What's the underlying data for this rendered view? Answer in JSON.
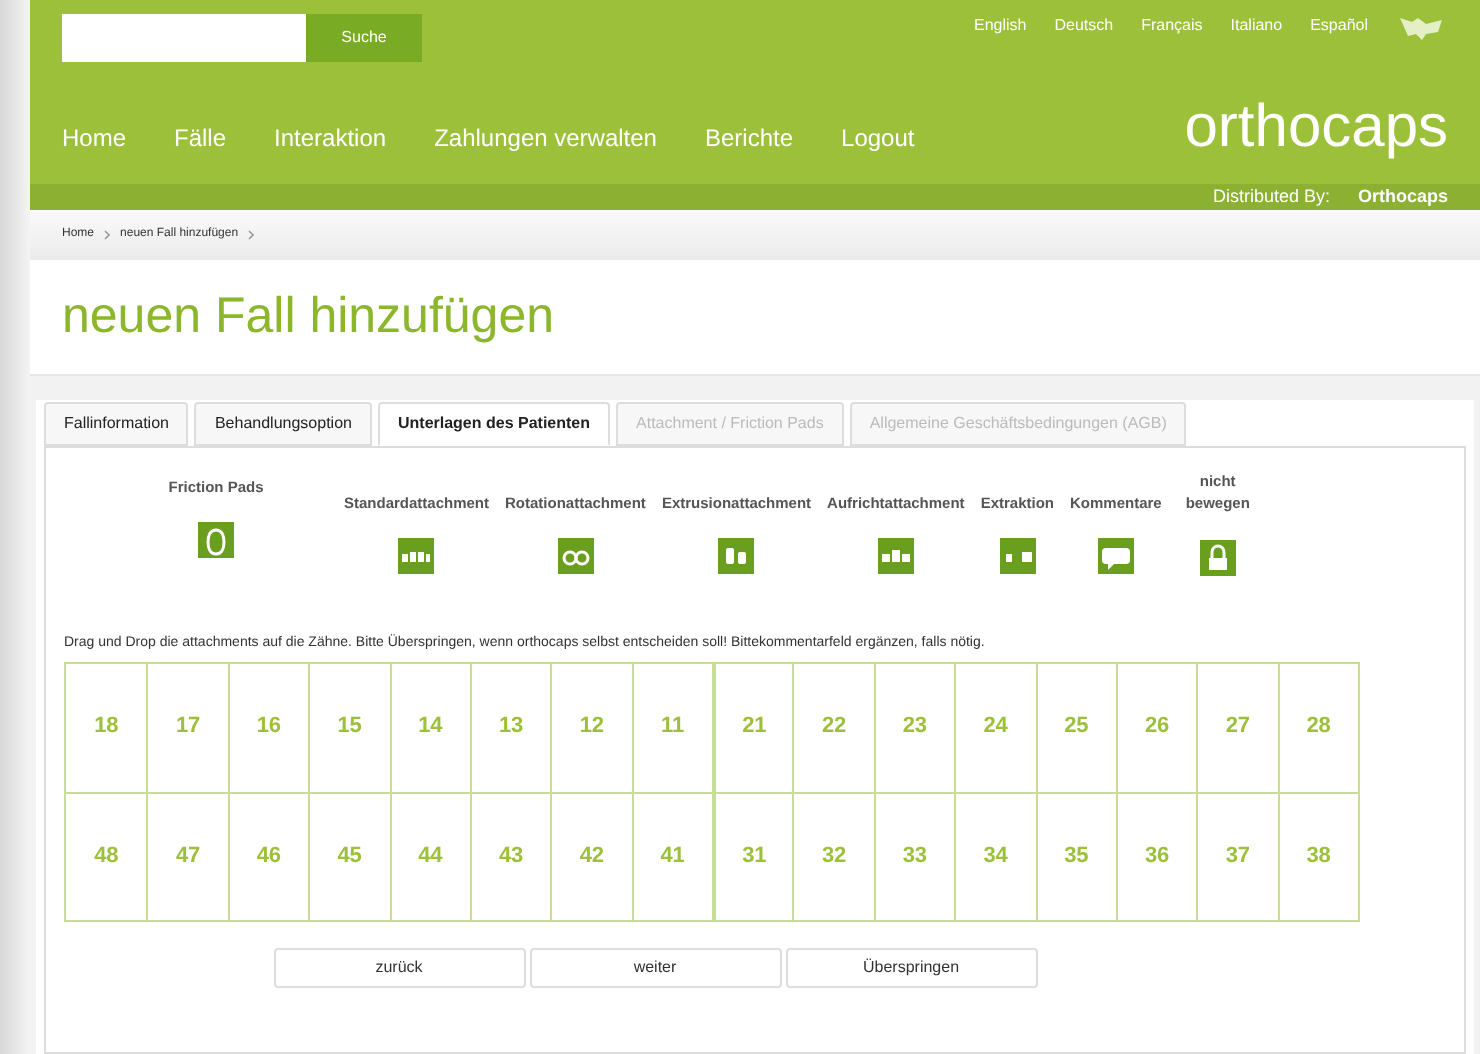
{
  "search": {
    "button": "Suche"
  },
  "languages": [
    "English",
    "Deutsch",
    "Français",
    "Italiano",
    "Español"
  ],
  "nav": [
    "Home",
    "Fälle",
    "Interaktion",
    "Zahlungen verwalten",
    "Berichte",
    "Logout"
  ],
  "logo": "orthocaps",
  "distributed": {
    "label": "Distributed By:",
    "value": "Orthocaps"
  },
  "breadcrumb": [
    "Home",
    "neuen Fall hinzufügen"
  ],
  "title": "neuen Fall hinzufügen",
  "tabs": [
    {
      "label": "Fallinformation",
      "selected": false,
      "disabled": false
    },
    {
      "label": "Behandlungsoption",
      "selected": false,
      "disabled": false
    },
    {
      "label": "Unterlagen des Patienten",
      "selected": true,
      "disabled": false
    },
    {
      "label": "Attachment / Friction Pads",
      "selected": false,
      "disabled": true
    },
    {
      "label": "Allgemeine Geschäftsbedingungen (AGB)",
      "selected": false,
      "disabled": true
    }
  ],
  "tools": [
    {
      "label": "Friction Pads",
      "kind": "pad"
    },
    {
      "label": "Standardattachment",
      "kind": "standard"
    },
    {
      "label": "Rotationattachment",
      "kind": "rotation"
    },
    {
      "label": "Extrusionattachment",
      "kind": "extrusion"
    },
    {
      "label": "Aufrichtattachment",
      "kind": "upright"
    },
    {
      "label": "Extraktion",
      "kind": "extraction"
    },
    {
      "label": "Kommentare",
      "kind": "comment"
    },
    {
      "label": "nicht bewegen",
      "kind": "lock"
    }
  ],
  "instruction": "Drag und Drop die attachments auf die Zähne. Bitte Überspringen, wenn orthocaps selbst entscheiden soll! Bittekommentarfeld ergänzen, falls nötig.",
  "teeth": [
    [
      "18",
      "17",
      "16",
      "15",
      "14",
      "13",
      "12",
      "11",
      "21",
      "22",
      "23",
      "24",
      "25",
      "26",
      "27",
      "28"
    ],
    [
      "48",
      "47",
      "46",
      "45",
      "44",
      "43",
      "42",
      "41",
      "31",
      "32",
      "33",
      "34",
      "35",
      "36",
      "37",
      "38"
    ]
  ],
  "buttons": [
    "zurück",
    "weiter",
    "Überspringen"
  ]
}
